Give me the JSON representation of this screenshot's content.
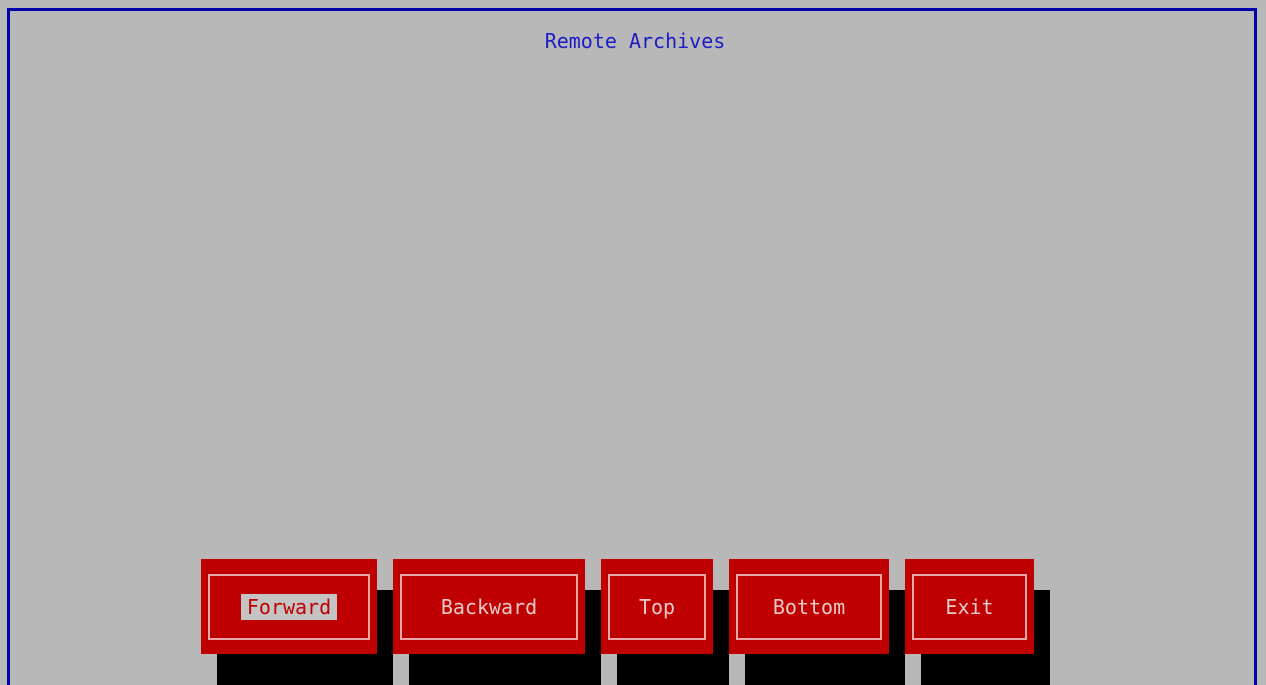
{
  "window": {
    "title": "Remote Archives"
  },
  "buttons": [
    {
      "label": "Forward",
      "selected": true
    },
    {
      "label": "Backward",
      "selected": false
    },
    {
      "label": "Top",
      "selected": false
    },
    {
      "label": "Bottom",
      "selected": false
    },
    {
      "label": "Exit",
      "selected": false
    }
  ],
  "colors": {
    "background": "#b8b8b8",
    "frame_border": "#0000a8",
    "title_text": "#1c1cc4",
    "button_bg": "#bf0000",
    "button_border": "#e8a8a8",
    "button_text": "#e8c8c8",
    "selected_label_bg": "#c4c4c4",
    "shadow": "#000000"
  }
}
